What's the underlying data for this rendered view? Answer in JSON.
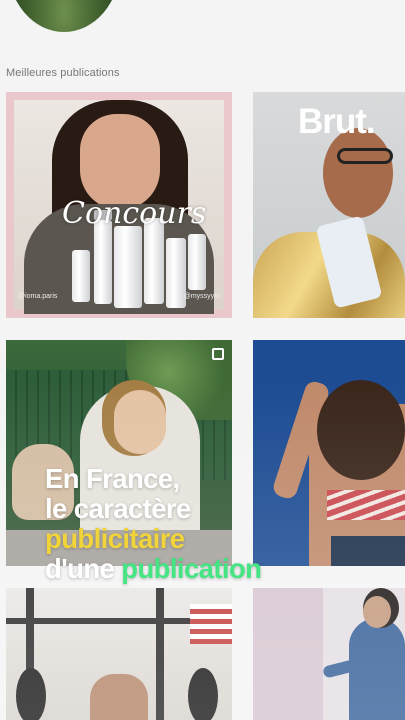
{
  "section": {
    "title": "Meilleures publications"
  },
  "posts": [
    {
      "id": "post-concours",
      "caption_overlay": "Concours",
      "handle_left": "@ioma.paris",
      "handle_right": "@myssyym",
      "brand": "ioma"
    },
    {
      "id": "post-brut",
      "caption_overlay": "Brut."
    },
    {
      "id": "post-bag"
    },
    {
      "id": "post-back"
    },
    {
      "id": "post-gym"
    },
    {
      "id": "post-suit"
    }
  ],
  "video_overlay": {
    "line1": "En France,",
    "line2": "le caractère",
    "line3": "publicitaire",
    "line4_white": "d'une ",
    "line4_green": "publication"
  },
  "colors": {
    "highlight_yellow": "#f1d43a",
    "highlight_green": "#45e584",
    "label_gray": "#777777"
  }
}
